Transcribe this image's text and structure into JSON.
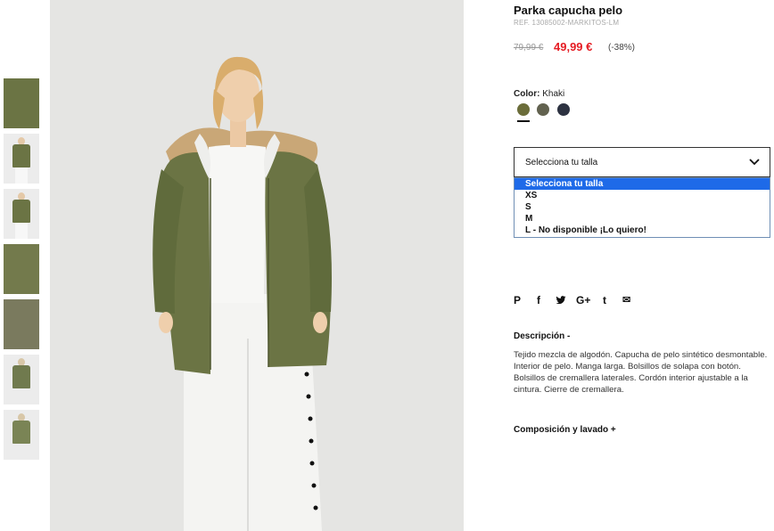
{
  "product": {
    "title": "Parka capucha pelo",
    "ref": "REF. 13085002-MARKITOS-LM",
    "old_price": "79,99 €",
    "new_price": "49,99 €",
    "discount": "(-38%)"
  },
  "color": {
    "label": "Color:",
    "value": "Khaki",
    "swatches": [
      {
        "name": "khaki",
        "hex": "#6b6d3a"
      },
      {
        "name": "olive-grey",
        "hex": "#62624f"
      },
      {
        "name": "navy",
        "hex": "#2d3241"
      }
    ]
  },
  "size": {
    "selected_label": "Selecciona tu talla",
    "options": [
      "Selecciona tu talla",
      "XS",
      "S",
      "M",
      "L - No disponible ¡Lo quiero!"
    ]
  },
  "share": {
    "icons": [
      "pinterest-icon",
      "facebook-icon",
      "twitter-icon",
      "google-plus-icon",
      "tumblr-icon",
      "email-icon"
    ],
    "glyphs": [
      "P",
      "f",
      "🐦",
      "G+",
      "t",
      "✉"
    ]
  },
  "description": {
    "heading": "Descripción -",
    "text": "Tejido mezcla de algodón. Capucha de pelo sintético desmontable. Interior de pelo. Manga larga. Bolsillos de solapa con botón. Bolsillos de cremallera laterales. Cordón interior ajustable a la cintura. Cierre de cremallera."
  },
  "composition": {
    "heading": "Composición y lavado +"
  },
  "colors": {
    "accent_red": "#e51c23",
    "highlight_blue": "#1e6ae8",
    "coat_green": "#6b7444"
  }
}
